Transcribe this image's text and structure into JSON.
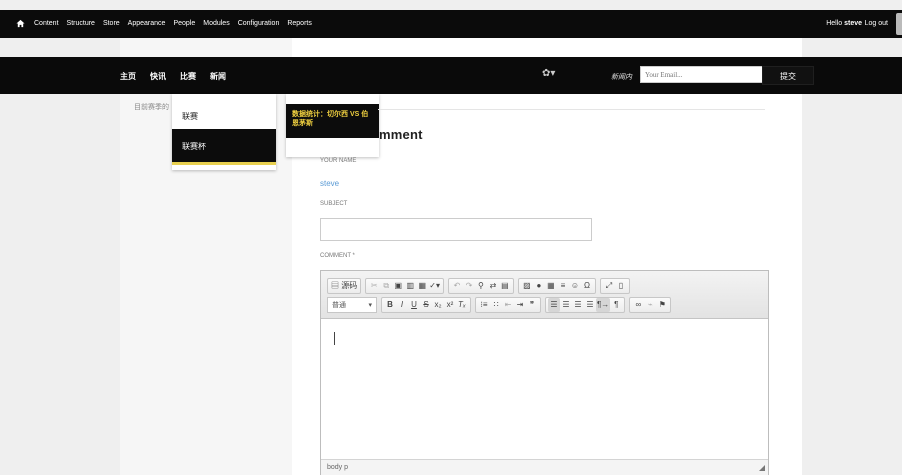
{
  "admin_bar": {
    "home_icon": "home-icon",
    "menu": [
      "Content",
      "Structure",
      "Store",
      "Appearance",
      "People",
      "Modules",
      "Configuration",
      "Reports"
    ],
    "greeting": "Hello",
    "username": "steve",
    "logout": "Log out"
  },
  "navbar": {
    "items": [
      "主页",
      "快讯",
      "比赛",
      "新闻"
    ],
    "settings_icon": "gear-icon",
    "search_label": "新闻内",
    "search_placeholder": "Your Email...",
    "submit_label": "提交"
  },
  "dropdown_primary": {
    "items": [
      "联赛",
      "联赛杯"
    ],
    "accent_color": "#e8d050"
  },
  "dropdown_secondary": {
    "item": "数据统计：切尔西 VS 伯恩茅斯",
    "text_color": "#f0d040"
  },
  "breadcrumb_text": "目前赛季的",
  "form": {
    "title": "mment",
    "your_name_label": "YOUR NAME",
    "your_name_value": "steve",
    "subject_label": "SUBJECT",
    "comment_label": "COMMENT *"
  },
  "editor": {
    "source_label": "源码",
    "format_label": "普通",
    "status_path": "body  p"
  }
}
